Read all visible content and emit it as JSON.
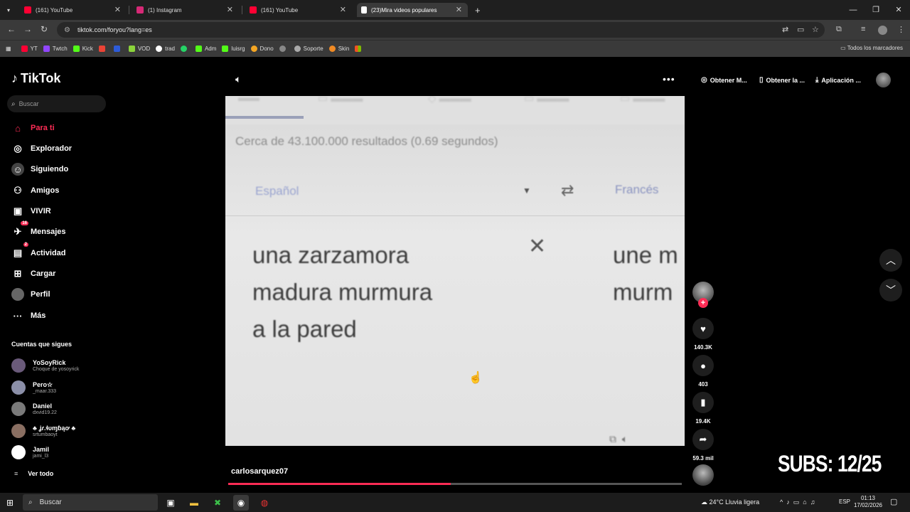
{
  "browser": {
    "tabs": [
      {
        "title": "(161) YouTube",
        "color": "#ff0033"
      },
      {
        "title": "(1) Instagram",
        "color": "#d62976"
      },
      {
        "title": "(161) YouTube",
        "color": "#ff0033"
      },
      {
        "title": "(23)Mira videos populares",
        "color": "#ffffff"
      }
    ],
    "url": "tiktok.com/foryou?lang=es",
    "bookmarks": [
      "YT",
      "Twtch",
      "Kick",
      "",
      "",
      "VOD",
      "trad",
      "",
      "Adm",
      "luisrg",
      "Dono",
      "",
      "Soporte",
      "Skin",
      ""
    ],
    "all_bookmarks": "Todos los marcadores"
  },
  "tiktok": {
    "logo": "TikTok",
    "search_placeholder": "Buscar",
    "nav": [
      {
        "label": "Para ti",
        "icon": "home-icon"
      },
      {
        "label": "Explorador",
        "icon": "compass-icon"
      },
      {
        "label": "Siguiendo",
        "icon": "following-icon"
      },
      {
        "label": "Amigos",
        "icon": "friends-icon"
      },
      {
        "label": "VIVIR",
        "icon": "live-icon"
      },
      {
        "label": "Mensajes",
        "icon": "messages-icon",
        "badge": "16"
      },
      {
        "label": "Actividad",
        "icon": "activity-icon",
        "badge": "2"
      },
      {
        "label": "Cargar",
        "icon": "upload-icon"
      },
      {
        "label": "Perfil",
        "icon": "profile-icon"
      },
      {
        "label": "Más",
        "icon": "more-icon"
      }
    ],
    "following_header": "Cuentas que sigues",
    "following": [
      {
        "name": "YoSoyRick",
        "handle": "Choque de yosoyrick"
      },
      {
        "name": "Pero☆",
        "handle": "_maar.333"
      },
      {
        "name": "Daniel",
        "handle": "dxvid19.22"
      },
      {
        "name": "♣ ʝɾ.ɬυɱɓąơ ♣",
        "handle": "srtumbaoyt"
      },
      {
        "name": "Jamil",
        "handle": "jami_l3"
      }
    ],
    "see_all": "Ver todo",
    "top_right": {
      "get_app1": "Obtener M...",
      "get_app2": "Obtener la ...",
      "app": "Aplicación ..."
    },
    "video": {
      "username": "carlosarquez07",
      "progress": 0.49,
      "likes": "140.3K",
      "comments": "403",
      "saves": "19.4K",
      "shares": "59.3 mil",
      "screen": {
        "results": "Cerca de 43.100.000 resultados (0.69 segundos)",
        "source_lang": "Español",
        "target_lang": "Francés",
        "source_text": "una zarzamora\nmadura murmura\na la pared",
        "target_text": "une m\nmurm"
      }
    },
    "overlay": "SUBS: 12/25"
  },
  "taskbar": {
    "search": "Buscar",
    "weather": "24°C  Lluvia ligera",
    "lang": "ESP",
    "time": "01:13",
    "date": "17/02/2026"
  }
}
